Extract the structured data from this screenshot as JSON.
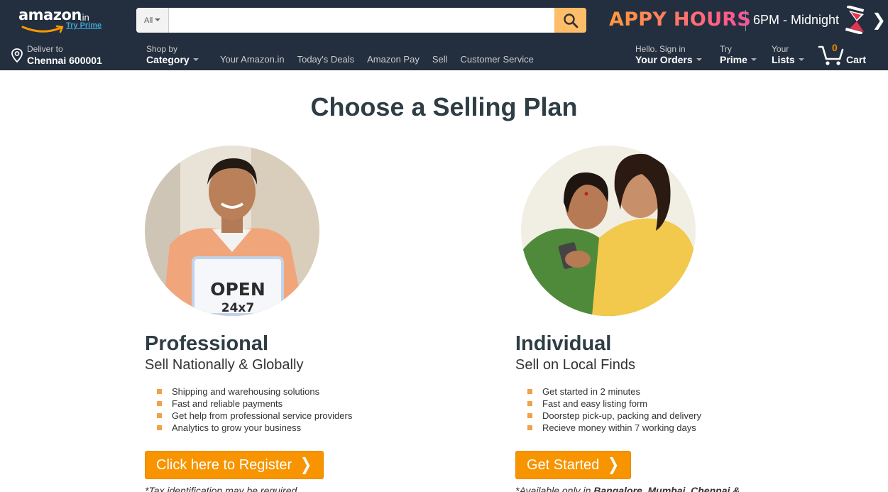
{
  "header": {
    "logo_text": "amazon",
    "logo_suffix": ".in",
    "logo_prime": "Try Prime",
    "search": {
      "department": "All",
      "placeholder": "",
      "value": ""
    },
    "promo": {
      "title": "APPY HOURS",
      "time": "6PM - Midnight"
    },
    "deliver": {
      "line1": "Deliver to",
      "line2": "Chennai 600001"
    },
    "shop_by": {
      "line1": "Shop by",
      "line2": "Category"
    },
    "nav_links": [
      "Your Amazon.in",
      "Today's Deals",
      "Amazon Pay",
      "Sell",
      "Customer Service"
    ],
    "account": {
      "line1": "Hello. Sign in",
      "line2": "Your Orders"
    },
    "prime": {
      "line1": "Try",
      "line2": "Prime"
    },
    "lists": {
      "line1": "Your",
      "line2": "Lists"
    },
    "cart": {
      "count": "0",
      "label": "Cart"
    }
  },
  "main": {
    "title": "Choose a Selling Plan",
    "plans": [
      {
        "name": "Professional",
        "tagline": "Sell Nationally & Globally",
        "photo_sign_line1": "OPEN",
        "photo_sign_line2": "24x7",
        "features": [
          "Shipping and warehousing solutions",
          "Fast and reliable payments",
          "Get help from professional service providers",
          "Analytics to grow your business"
        ],
        "button": "Click here to Register",
        "note": "*Tax identification may be required"
      },
      {
        "name": "Individual",
        "tagline": "Sell on Local Finds",
        "features": [
          "Get started in 2 minutes",
          "Fast and easy listing form",
          "Doorstep pick-up, packing and delivery",
          "Recieve money within 7 working days"
        ],
        "button": "Get Started",
        "note_prefix": "*Available only in ",
        "note_bold": "Bangalore, Mumbai, Chennai &"
      }
    ]
  },
  "colors": {
    "header_bg": "#232f3e",
    "accent_orange": "#f79400",
    "search_button": "#febd69",
    "bullet": "#f0a14a",
    "title_text": "#2f3d45"
  }
}
